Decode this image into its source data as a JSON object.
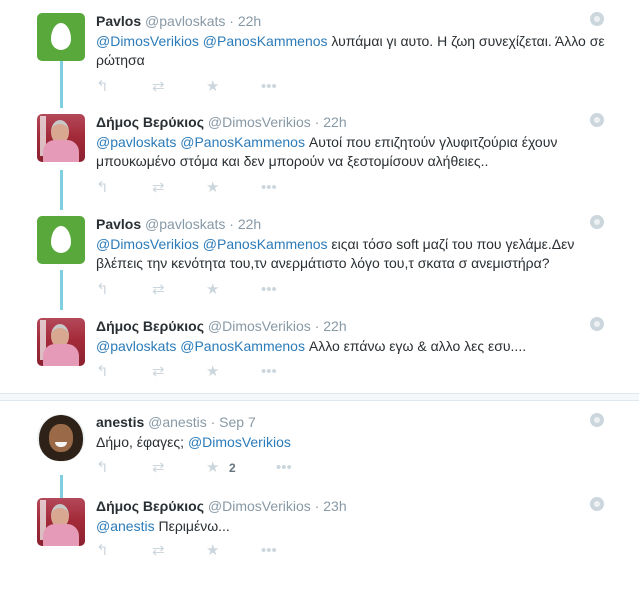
{
  "tweets": [
    {
      "name": "Pavlos",
      "handle": "@pavloskats",
      "sep": "·",
      "time": "22h",
      "parts": [
        [
          "m",
          "@DimosVerikios"
        ],
        [
          "t",
          " "
        ],
        [
          "m",
          "@PanosKammenos"
        ],
        [
          "t",
          " λυπάμαι γι αυτο. Η ζωη συνεχίζεται. Άλλο σε ρώτησα"
        ]
      ],
      "avatar": "egg"
    },
    {
      "name": "Δήμος Βερύκιος",
      "handle": "@DimosVerikios",
      "sep": "·",
      "time": "22h",
      "parts": [
        [
          "m",
          "@pavloskats"
        ],
        [
          "t",
          " "
        ],
        [
          "m",
          "@PanosKammenos"
        ],
        [
          "t",
          " Αυτοί που επιζητούν γλυφιτζούρια έχουν μπουκωμένο στόμα και δεν μπορούν να ξεστομίσουν αλήθειες.."
        ]
      ],
      "avatar": "photo"
    },
    {
      "name": "Pavlos",
      "handle": "@pavloskats",
      "sep": "·",
      "time": "22h",
      "parts": [
        [
          "m",
          "@DimosVerikios"
        ],
        [
          "t",
          " "
        ],
        [
          "m",
          "@PanosKammenos"
        ],
        [
          "t",
          " ειςαι τόσο soft μαζί του που γελάμε.Δεν βλέπεις την κενότητα του,τν ανερμάτιστο λόγο του,τ σκατα σ ανεμιστήρα?"
        ]
      ],
      "avatar": "egg"
    },
    {
      "name": "Δήμος Βερύκιος",
      "handle": "@DimosVerikios",
      "sep": "·",
      "time": "22h",
      "parts": [
        [
          "m",
          "@pavloskats"
        ],
        [
          "t",
          " "
        ],
        [
          "m",
          "@PanosKammenos"
        ],
        [
          "t",
          " Αλλο επάνω εγω & αλλο λες εσυ...."
        ]
      ],
      "avatar": "photo"
    },
    {
      "name": "anestis",
      "handle": "@anestis",
      "sep": "·",
      "time": "Sep 7",
      "parts": [
        [
          "t",
          "Δήμο, έφαγες; "
        ],
        [
          "m",
          "@DimosVerikios"
        ]
      ],
      "avatar": "bearded",
      "favorite_count": "2"
    },
    {
      "name": "Δήμος Βερύκιος",
      "handle": "@DimosVerikios",
      "sep": "·",
      "time": "23h",
      "parts": [
        [
          "m",
          "@anestis"
        ],
        [
          "t",
          " Περιμένω..."
        ]
      ],
      "avatar": "photo"
    }
  ],
  "icons": {
    "reply": "reply-icon",
    "retweet": "retweet-icon",
    "favorite": "star-icon",
    "more": "more-icon",
    "globe": "globe-icon"
  }
}
